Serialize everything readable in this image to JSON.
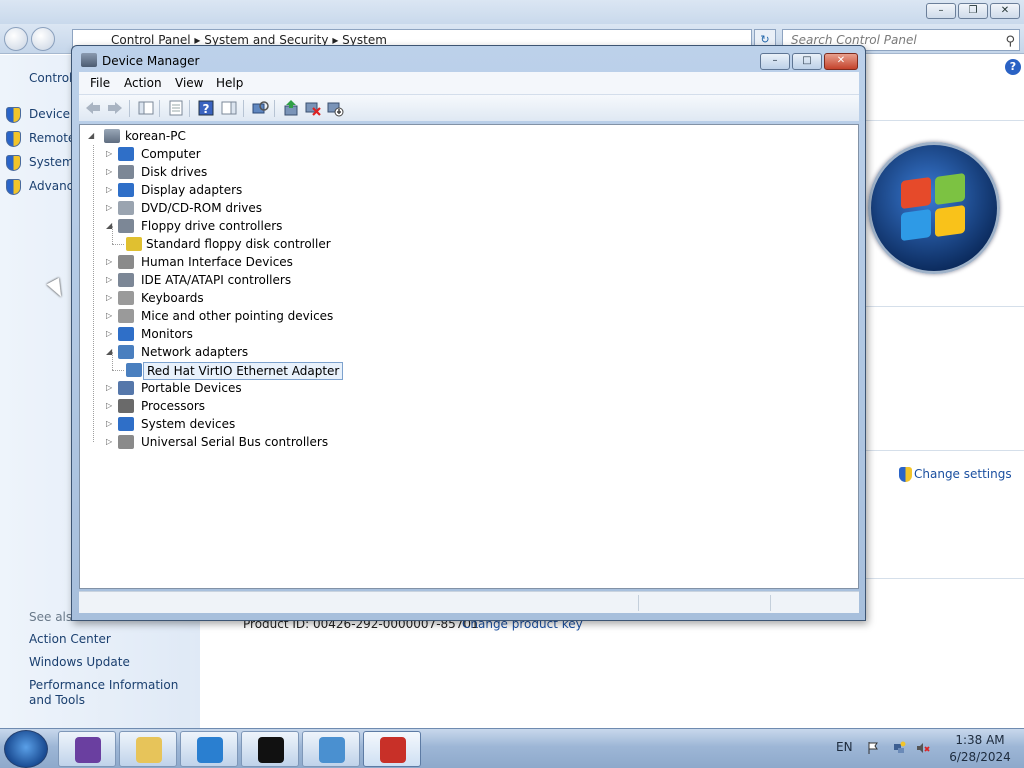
{
  "control_panel": {
    "breadcrumb": [
      "Control Panel",
      "System and Security",
      "System"
    ],
    "search_placeholder": "Search Control Panel",
    "left_title": "Control",
    "left_links": [
      "Device M",
      "Remote",
      "System",
      "Advanc"
    ],
    "see_also": "See also",
    "see_also_links": [
      "Action Center",
      "Windows Update",
      "Performance Information and Tools"
    ],
    "product_id": "Product ID: 00426-292-0000007-85701",
    "change_product_key": "Change product key",
    "change_settings": "Change settings"
  },
  "device_manager": {
    "title": "Device Manager",
    "menu": [
      "File",
      "Action",
      "View",
      "Help"
    ],
    "root": "korean-PC",
    "nodes": [
      {
        "label": "Computer",
        "expanded": false,
        "icon_color": "#2f6fc8"
      },
      {
        "label": "Disk drives",
        "expanded": false,
        "icon_color": "#7c8796"
      },
      {
        "label": "Display adapters",
        "expanded": false,
        "icon_color": "#2f6fc8"
      },
      {
        "label": "DVD/CD-ROM drives",
        "expanded": false,
        "icon_color": "#9aa4b0"
      },
      {
        "label": "Floppy drive controllers",
        "expanded": true,
        "icon_color": "#7c8796"
      },
      {
        "label": "Standard floppy disk controller",
        "child": true,
        "icon_color": "#e0c030"
      },
      {
        "label": "Human Interface Devices",
        "expanded": false,
        "icon_color": "#8a8a8a"
      },
      {
        "label": "IDE ATA/ATAPI controllers",
        "expanded": false,
        "icon_color": "#7c8796"
      },
      {
        "label": "Keyboards",
        "expanded": false,
        "icon_color": "#9a9a9a"
      },
      {
        "label": "Mice and other pointing devices",
        "expanded": false,
        "icon_color": "#9a9a9a"
      },
      {
        "label": "Monitors",
        "expanded": false,
        "icon_color": "#2f6fc8"
      },
      {
        "label": "Network adapters",
        "expanded": true,
        "icon_color": "#4a7fbf"
      },
      {
        "label": "Red Hat VirtIO Ethernet Adapter",
        "child": true,
        "selected": true,
        "icon_color": "#4a7fbf"
      },
      {
        "label": "Portable Devices",
        "expanded": false,
        "icon_color": "#5577aa"
      },
      {
        "label": "Processors",
        "expanded": false,
        "icon_color": "#6a6a6a"
      },
      {
        "label": "System devices",
        "expanded": false,
        "icon_color": "#2f6fc8"
      },
      {
        "label": "Universal Serial Bus controllers",
        "expanded": false,
        "icon_color": "#8a8a8a"
      }
    ]
  },
  "taskbar": {
    "lang": "EN",
    "time": "1:38 AM",
    "date": "6/28/2024",
    "items": [
      {
        "name": "media-player-icon",
        "color": "#6a3fa0"
      },
      {
        "name": "explorer-folder-icon",
        "color": "#e7c45a"
      },
      {
        "name": "internet-explorer-icon",
        "color": "#2a7fd0"
      },
      {
        "name": "command-prompt-icon",
        "color": "#111111"
      },
      {
        "name": "control-panel-icon",
        "color": "#4a90d0"
      },
      {
        "name": "toolbox-icon",
        "color": "#c83028"
      }
    ]
  }
}
